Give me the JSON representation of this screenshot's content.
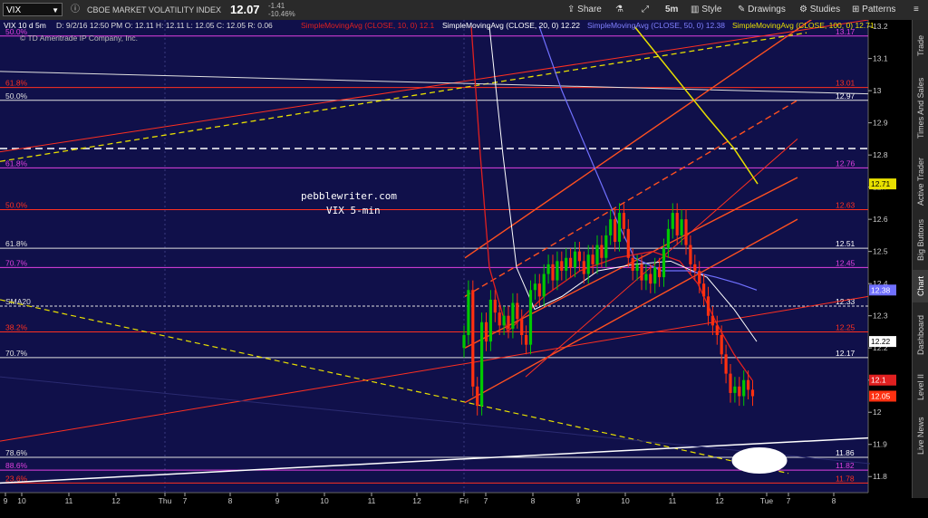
{
  "toolbar": {
    "symbol": "VIX",
    "title": "CBOE MARKET VOLATILITY INDEX",
    "last": "12.07",
    "change": "-1.41",
    "change_pct": "-10.46%",
    "share": "Share",
    "interval": "5m",
    "style": "Style",
    "drawings": "Drawings",
    "studies": "Studies",
    "patterns": "Patterns"
  },
  "header": {
    "chart_desc": "VIX 10 d 5m",
    "ohlc": "D: 9/2/16 12:50 PM   O: 12.11   H: 12.11   L: 12.05   C: 12.05   R: 0.06",
    "copyright": "© TD Ameritrade IP Company, Inc.",
    "studies": [
      {
        "text": "SimpleMovingAvg (CLOSE, 10, 0)",
        "value": "12.1",
        "color": "#e02020"
      },
      {
        "text": "SimpleMovingAvg (CLOSE, 20, 0)",
        "value": "12.22",
        "color": "#ffffff"
      },
      {
        "text": "SimpleMovingAvg (CLOSE, 50, 0)",
        "value": "12.38",
        "color": "#7070ff"
      },
      {
        "text": "SimpleMovingAvg (CLOSE, 100, 0)",
        "value": "12.71",
        "color": "#e8e000"
      }
    ]
  },
  "annotation": {
    "line1": "pebblewriter.com",
    "line2": "VIX 5-min"
  },
  "sidebar": [
    "Trade",
    "Times And Sales",
    "Active Trader",
    "Big Buttons",
    "Chart",
    "Dashboard",
    "Level II",
    "Live News"
  ],
  "colors": {
    "background": "#10104a",
    "up": "#00c800",
    "down": "#ff3010",
    "fib_red": "#ff3020",
    "fib_purple": "#e040e0",
    "fib_white": "#e0e0e0"
  },
  "chart_data": {
    "type": "candlestick",
    "ylim": [
      11.75,
      13.22
    ],
    "y_ticks": [
      11.8,
      11.9,
      12.0,
      12.1,
      12.2,
      12.3,
      12.4,
      12.5,
      12.6,
      12.7,
      12.8,
      12.9,
      13.0,
      13.1,
      13.2
    ],
    "x_tick_labels": [
      "9",
      "10",
      "11",
      "12",
      "Thu",
      "7",
      "8",
      "9",
      "10",
      "11",
      "12",
      "Fri",
      "7",
      "8",
      "9",
      "10",
      "11",
      "12",
      "Tue",
      "7",
      "8"
    ],
    "fib_levels": [
      {
        "level": 13.17,
        "label": "50.0%",
        "value": "13.17",
        "color": "#e040e0"
      },
      {
        "level": 13.01,
        "label": "61.8%",
        "value": "13.01",
        "color": "#ff3020"
      },
      {
        "level": 12.97,
        "label": "50.0%",
        "value": "12.97",
        "color": "#e0e0e0"
      },
      {
        "level": 12.76,
        "label": "61.8%",
        "value": "12.76",
        "color": "#e040e0"
      },
      {
        "level": 12.63,
        "label": "50.0%",
        "value": "12.63",
        "color": "#ff3020"
      },
      {
        "level": 12.51,
        "label": "61.8%",
        "value": "12.51",
        "color": "#e0e0e0"
      },
      {
        "level": 12.45,
        "label": "70.7%",
        "value": "12.45",
        "color": "#e040e0"
      },
      {
        "level": 12.33,
        "label": "SMA20",
        "value": "12.33",
        "color": "#e0e0e0"
      },
      {
        "level": 12.25,
        "label": "38.2%",
        "value": "12.25",
        "color": "#ff3020"
      },
      {
        "level": 12.17,
        "label": "70.7%",
        "value": "12.17",
        "color": "#e0e0e0"
      },
      {
        "level": 11.86,
        "label": "78.6%",
        "value": "11.86",
        "color": "#e0e0e0"
      },
      {
        "level": 11.82,
        "label": "88.6%",
        "value": "11.82",
        "color": "#e040e0"
      },
      {
        "level": 11.78,
        "label": "23.6%",
        "value": "11.78",
        "color": "#ff3020"
      }
    ],
    "price_tags": [
      {
        "value": "12.71",
        "bg": "#e8e000",
        "fg": "#000"
      },
      {
        "value": "12.38",
        "bg": "#7070ff",
        "fg": "#fff"
      },
      {
        "value": "12.22",
        "bg": "#ffffff",
        "fg": "#000"
      },
      {
        "value": "12.1",
        "bg": "#e02020",
        "fg": "#fff"
      },
      {
        "value": "12.05",
        "bg": "#ff3010",
        "fg": "#fff"
      }
    ],
    "candles_close": [
      12.24,
      12.38,
      12.08,
      12.02,
      12.28,
      12.22,
      12.35,
      12.31,
      12.27,
      12.3,
      12.26,
      12.34,
      12.29,
      12.24,
      12.21,
      12.38,
      12.4,
      12.36,
      12.43,
      12.46,
      12.41,
      12.47,
      12.44,
      12.48,
      12.45,
      12.5,
      12.47,
      12.43,
      12.49,
      12.46,
      12.52,
      12.48,
      12.55,
      12.6,
      12.53,
      12.62,
      12.57,
      12.48,
      12.44,
      12.46,
      12.41,
      12.43,
      12.4,
      12.45,
      12.42,
      12.51,
      12.57,
      12.62,
      12.55,
      12.6,
      12.52,
      12.46,
      12.44,
      12.4,
      12.36,
      12.3,
      12.27,
      12.24,
      12.18,
      12.12,
      12.06,
      12.08,
      12.05,
      12.1,
      12.07,
      12.05
    ]
  }
}
